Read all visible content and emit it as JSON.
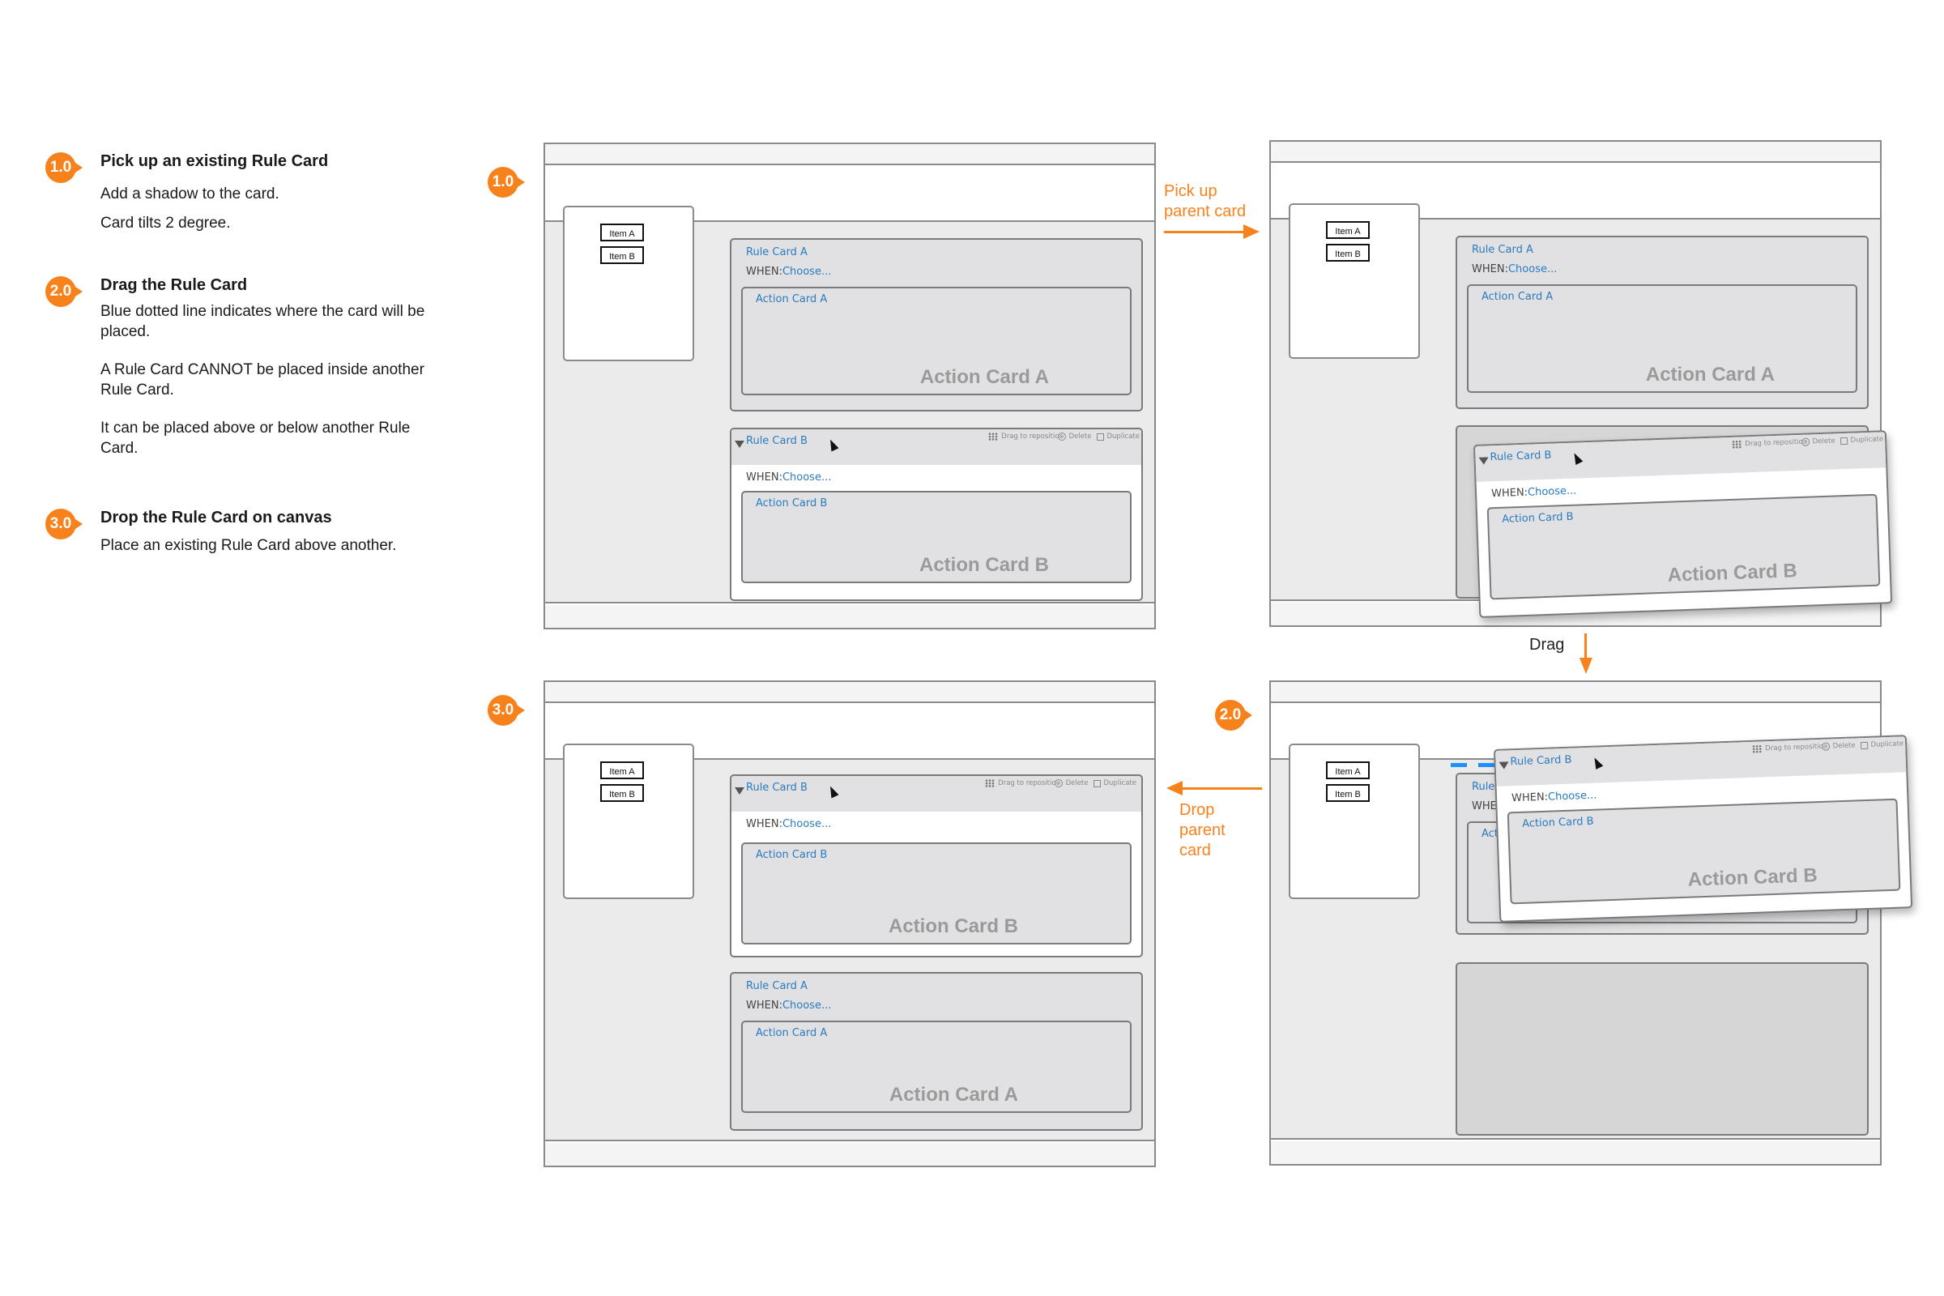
{
  "colors": {
    "accent": "#f7821b",
    "link_blue": "#2a7bbf",
    "drop_indicator": "#1e90ff"
  },
  "steps": [
    {
      "badge": "1.0",
      "title": "Pick up an existing Rule Card",
      "lines": [
        "Add a shadow to the card.",
        "Card tilts 2 degree."
      ]
    },
    {
      "badge": "2.0",
      "title": "Drag the Rule Card",
      "lines": [
        "Blue dotted line indicates where the card will be placed.",
        "A Rule Card CANNOT be placed inside another Rule Card.",
        "It can be placed above or below another Rule Card."
      ]
    },
    {
      "badge": "3.0",
      "title": "Drop the Rule Card on canvas",
      "lines": [
        "Place an existing Rule Card above another."
      ]
    }
  ],
  "transitions": {
    "pick_up": "Pick up\nparent card",
    "pick_up_l1": "Pick up",
    "pick_up_l2": "parent card",
    "drag": "Drag",
    "drop_l1": "Drop",
    "drop_l2": "parent",
    "drop_l3": "card"
  },
  "palette": {
    "items": [
      "Item A",
      "Item B"
    ]
  },
  "card": {
    "rule_a": "Rule Card A",
    "rule_b": "Rule Card B",
    "when_label": "WHEN:",
    "when_value": "Choose...",
    "action_a": "Action Card A",
    "action_b": "Action Card B",
    "toolbar": {
      "drag": "Drag to repositio",
      "delete_icon": "⊗",
      "delete": "Delete",
      "duplicate": "Duplicate"
    }
  },
  "frames": [
    {
      "badge": "1.0",
      "state": "initial"
    },
    {
      "badge": "",
      "state": "picked-up"
    },
    {
      "badge": "2.0",
      "state": "dragging"
    },
    {
      "badge": "3.0",
      "state": "dropped"
    }
  ]
}
